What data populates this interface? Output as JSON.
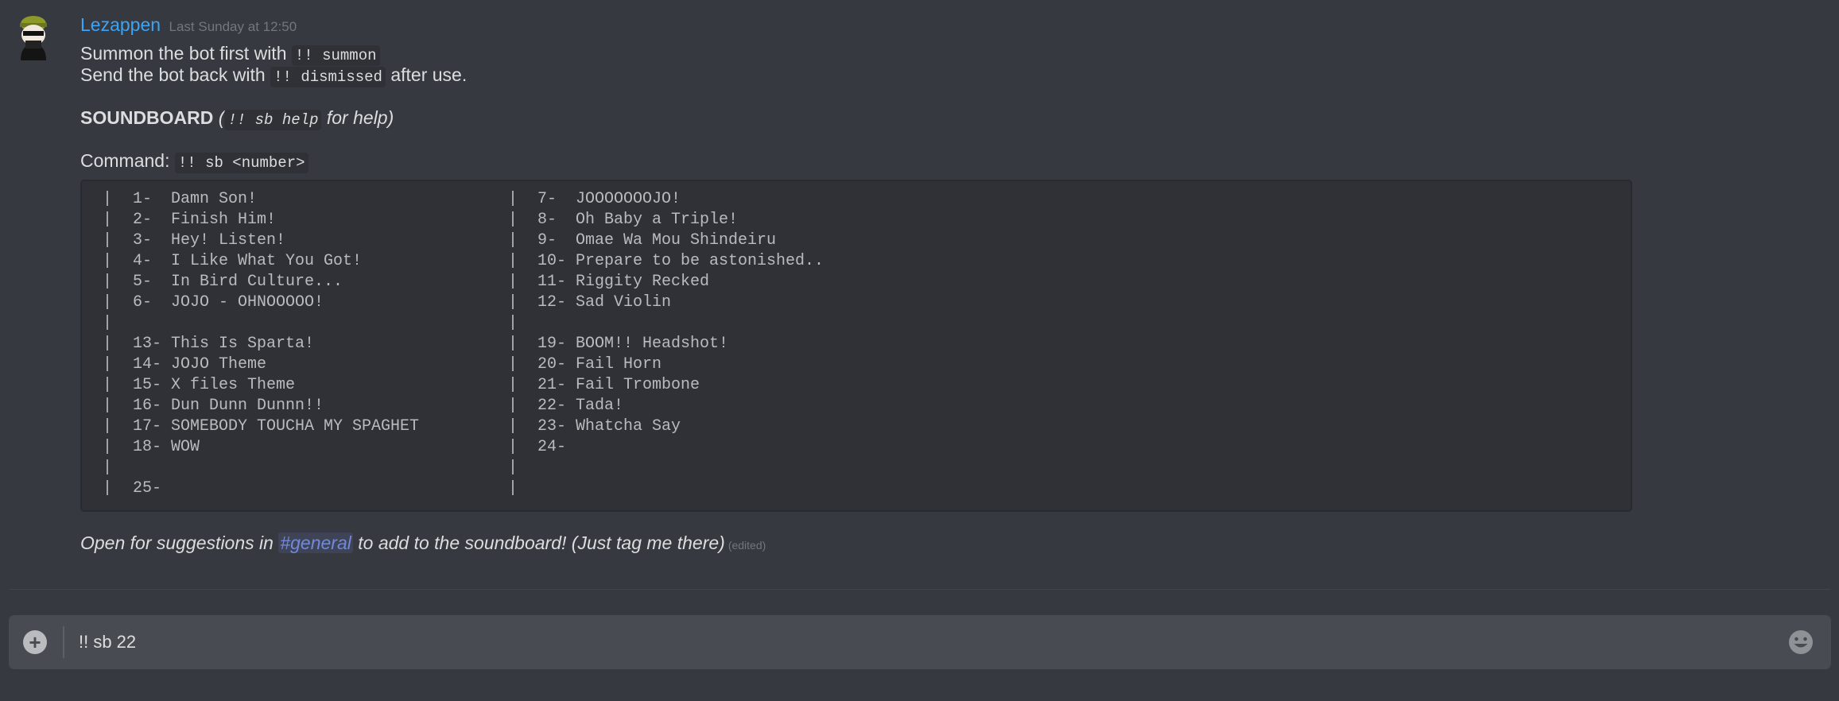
{
  "message": {
    "username": "Lezappen",
    "timestamp": "Last Sunday at 12:50",
    "line1": {
      "text": "Summon the bot first with ",
      "code": "!! summon"
    },
    "line2": {
      "text": "Send the bot back with ",
      "code": "!! dismissed",
      "suffix": " after use."
    },
    "soundboard": {
      "title": "SOUNDBOARD",
      "open": " (",
      "code": "!! sb help",
      "suffix": " for help)"
    },
    "command": {
      "label": "Command: ",
      "code": "!! sb <number>"
    },
    "soundboard_rows": [
      {
        "left": "1-  Damn Son!",
        "right": "7-  JOOOOOOOJO!"
      },
      {
        "left": "2-  Finish Him!",
        "right": "8-  Oh Baby a Triple!"
      },
      {
        "left": "3-  Hey! Listen!",
        "right": "9-  Omae Wa Mou Shindeiru"
      },
      {
        "left": "4-  I Like What You Got!",
        "right": "10- Prepare to be astonished.."
      },
      {
        "left": "5-  In Bird Culture...",
        "right": "11- Riggity Recked"
      },
      {
        "left": "6-  JOJO - OHNOOOOO!",
        "right": "12- Sad Violin"
      },
      {
        "left": "",
        "right": ""
      },
      {
        "left": "13- This Is Sparta!",
        "right": "19- BOOM!! Headshot!"
      },
      {
        "left": "14- JOJO Theme",
        "right": "20- Fail Horn"
      },
      {
        "left": "15- X files Theme",
        "right": "21- Fail Trombone"
      },
      {
        "left": "16- Dun Dunn Dunnn!!",
        "right": "22- Tada!"
      },
      {
        "left": "17- SOMEBODY TOUCHA MY SPAGHET",
        "right": "23- Whatcha Say"
      },
      {
        "left": "18- WOW",
        "right": "24-"
      },
      {
        "left": "",
        "right": ""
      },
      {
        "left": "25-",
        "right": ""
      }
    ],
    "pipe": "|",
    "footer": {
      "prefix": "Open for suggestions in ",
      "channel": "#general",
      "suffix": " to add to the soundboard! (Just tag me there)",
      "edited": "(edited)"
    }
  },
  "composer": {
    "value": "!! sb 22",
    "add_icon": "plus-circle-icon",
    "emoji_icon": "smiley-icon"
  },
  "colors": {
    "background": "#36393f",
    "username": "#3ea3f2",
    "mention": "#7289da",
    "codeblock": "#2f3136",
    "composer": "#484c52"
  }
}
